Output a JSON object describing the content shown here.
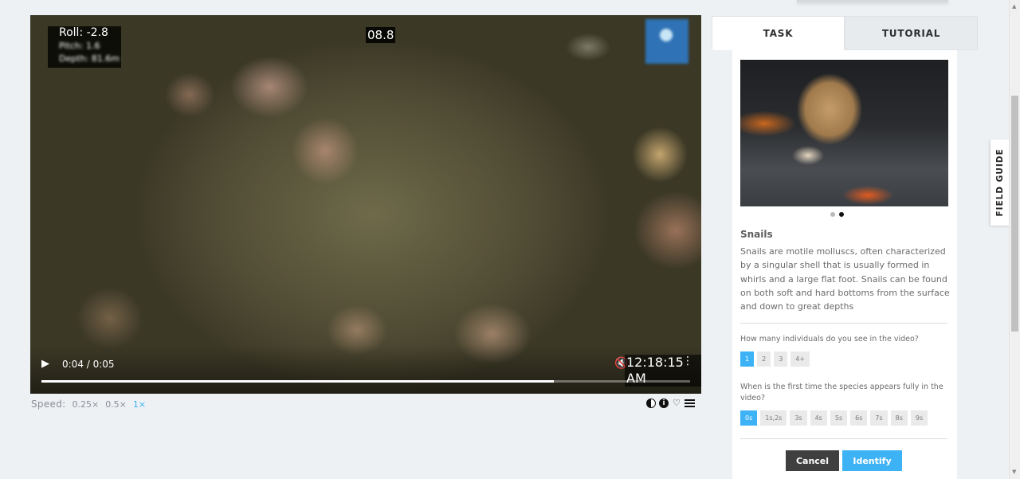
{
  "video": {
    "hud": {
      "roll": "Roll: -2.8",
      "pitch": "Pitch: 1.6",
      "depth": "Depth: 81.6m"
    },
    "heading": "08.8",
    "timestamp": "12:18:15 AM",
    "time_display": "0:04 / 0:05",
    "progress": 0.79
  },
  "speed": {
    "label": "Speed:",
    "options": [
      "0.25×",
      "0.5×",
      "1×"
    ],
    "selected": "1×"
  },
  "tabs": [
    "TASK",
    "TUTORIAL"
  ],
  "active_tab": "TASK",
  "field_guide_label": "FIELD GUIDE",
  "species": {
    "name": "Snails",
    "description": "Snails are motile molluscs, often characterized by a singular shell that is usually formed in whirls and a large flat foot. Snails can be found on both soft and hard bottoms from the surface and down to great depths",
    "image_dots": 2,
    "active_dot": 2
  },
  "questions": [
    {
      "text": "How many individuals do you see in the video?",
      "options": [
        "1",
        "2",
        "3",
        "4+"
      ],
      "selected": "1"
    },
    {
      "text": "When is the first time the species appears fully in the video?",
      "options": [
        "0s",
        "1s,2s",
        "3s",
        "4s",
        "5s",
        "6s",
        "7s",
        "8s",
        "9s"
      ],
      "selected": "0s"
    }
  ],
  "actions": {
    "cancel": "Cancel",
    "identify": "Identify"
  },
  "colors": {
    "accent": "#3db2f5",
    "cancel_bg": "#3f3f3f"
  },
  "icons": [
    "contrast-icon",
    "info-icon",
    "heart-icon",
    "list-icon",
    "play-icon",
    "mute-icon",
    "fullscreen-icon",
    "more-icon"
  ]
}
